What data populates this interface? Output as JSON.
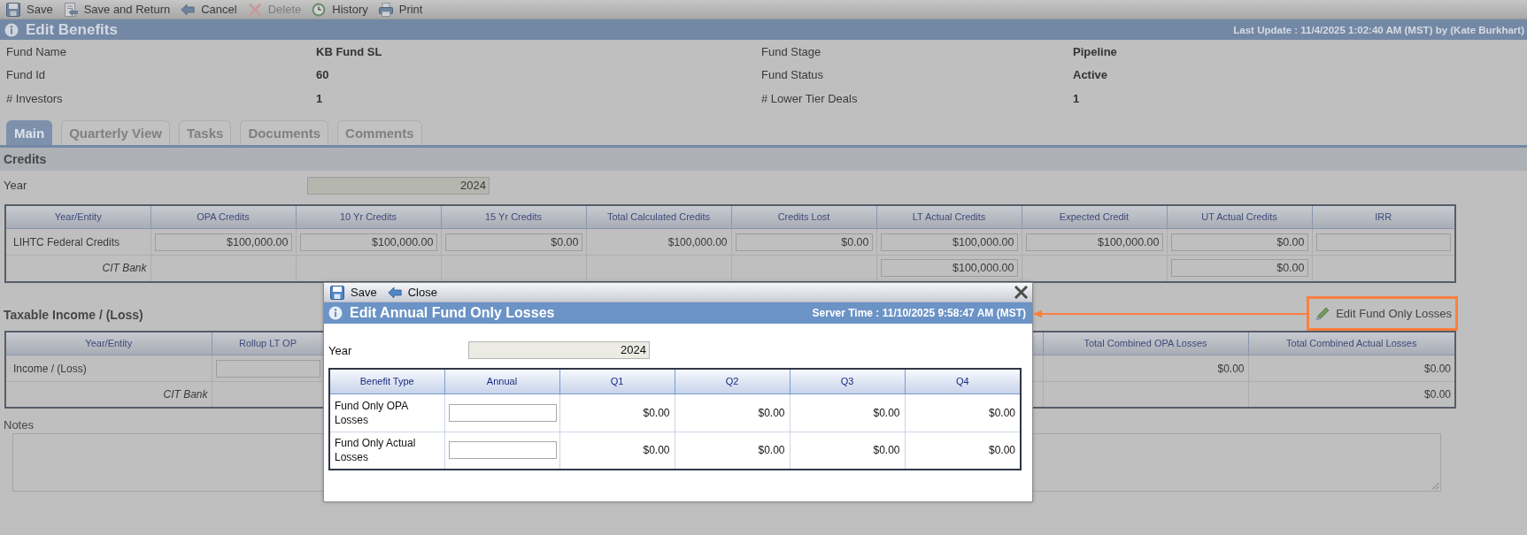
{
  "toolbar": [
    {
      "label": "Save",
      "kind": "save",
      "disabled": false
    },
    {
      "label": "Save and Return",
      "kind": "return",
      "disabled": false
    },
    {
      "label": "Cancel",
      "kind": "back",
      "disabled": false
    },
    {
      "label": "Delete",
      "kind": "delete",
      "disabled": true
    },
    {
      "label": "History",
      "kind": "history",
      "disabled": false
    },
    {
      "label": "Print",
      "kind": "print",
      "disabled": false
    }
  ],
  "header": {
    "title": "Edit Benefits",
    "last_update": "Last Update : 11/4/2025 1:02:40 AM (MST) by (Kate Burkhart)"
  },
  "fund_info": [
    {
      "label": "Fund Name",
      "value": "KB Fund SL"
    },
    {
      "label": "Fund Stage",
      "value": "Pipeline"
    },
    {
      "label": "Fund Id",
      "value": "60"
    },
    {
      "label": "Fund Status",
      "value": "Active"
    },
    {
      "label": "# Investors",
      "value": "1"
    },
    {
      "label": "# Lower Tier Deals",
      "value": "1"
    }
  ],
  "tabs": [
    {
      "label": "Main",
      "selected": true
    },
    {
      "label": "Quarterly View",
      "selected": false
    },
    {
      "label": "Tasks",
      "selected": false
    },
    {
      "label": "Documents",
      "selected": false
    },
    {
      "label": "Comments",
      "selected": false
    }
  ],
  "credits": {
    "title": "Credits",
    "year_label": "Year",
    "year": "2024",
    "table": {
      "columns": [
        "Year/Entity",
        "OPA Credits",
        "10 Yr Credits",
        "15 Yr Credits",
        "Total Calculated Credits",
        "Credits Lost",
        "LT Actual Credits",
        "Expected Credit",
        "UT Actual Credits",
        "IRR"
      ],
      "rows": [
        {
          "kind": "item",
          "cells": [
            {
              "kind": "label",
              "value": "LIHTC Federal Credits"
            },
            {
              "kind": "input",
              "value": "$100,000.00"
            },
            {
              "kind": "input",
              "value": "$100,000.00"
            },
            {
              "kind": "input",
              "value": "$0.00"
            },
            {
              "kind": "text",
              "value": "$100,000.00"
            },
            {
              "kind": "input",
              "value": "$0.00"
            },
            {
              "kind": "input",
              "value": "$100,000.00"
            },
            {
              "kind": "input",
              "value": "$100,000.00"
            },
            {
              "kind": "input",
              "value": "$0.00"
            },
            {
              "kind": "input"
            }
          ]
        },
        {
          "kind": "entity",
          "cells": [
            {
              "kind": "label",
              "value": "CIT Bank"
            },
            "",
            "",
            "",
            "",
            "",
            {
              "kind": "input",
              "value": "$100,000.00"
            },
            "",
            {
              "kind": "input",
              "value": "$0.00"
            },
            ""
          ]
        }
      ]
    }
  },
  "taxable_income": {
    "title": "Taxable Income / (Loss)",
    "link": "Edit Fund Only Losses",
    "table": {
      "columns": [
        "Year/Entity",
        "Rollup LT OP",
        "",
        "Total Combined OPA Losses",
        "Total Combined Actual Losses"
      ],
      "rows": [
        {
          "kind": "item",
          "cells": [
            {
              "kind": "label",
              "value": "Income / (Loss)"
            },
            {
              "kind": "input"
            },
            "",
            {
              "kind": "text",
              "value": "$0.00"
            },
            {
              "kind": "text",
              "value": "$0.00"
            }
          ]
        },
        {
          "kind": "entity",
          "cells": [
            {
              "kind": "label",
              "value": "CIT Bank"
            },
            "",
            "",
            "",
            {
              "kind": "text",
              "value": "$0.00"
            }
          ]
        }
      ]
    }
  },
  "notes": {
    "label": "Notes"
  },
  "dialog": {
    "toolbar": [
      {
        "label": "Save",
        "kind": "save",
        "disabled": false
      },
      {
        "label": "Close",
        "kind": "back",
        "disabled": false
      }
    ],
    "title": "Edit Annual Fund Only Losses",
    "server_time": "Server Time : 11/10/2025 9:58:47 AM (MST)",
    "year_label": "Year",
    "year": "2024",
    "table": {
      "columns": [
        "Benefit Type",
        "Annual",
        "Q1",
        "Q2",
        "Q3",
        "Q4"
      ],
      "rows": [
        {
          "cells": [
            {
              "kind": "label",
              "value": "Fund Only OPA Losses"
            },
            {
              "kind": "input"
            },
            {
              "kind": "text",
              "value": "$0.00"
            },
            {
              "kind": "text",
              "value": "$0.00"
            },
            {
              "kind": "text",
              "value": "$0.00"
            },
            {
              "kind": "text",
              "value": "$0.00"
            }
          ]
        },
        {
          "cells": [
            {
              "kind": "label",
              "value": "Fund Only Actual Losses"
            },
            {
              "kind": "input"
            },
            {
              "kind": "text",
              "value": "$0.00"
            },
            {
              "kind": "text",
              "value": "$0.00"
            },
            {
              "kind": "text",
              "value": "$0.00"
            },
            {
              "kind": "text",
              "value": "$0.00"
            }
          ]
        }
      ]
    }
  }
}
